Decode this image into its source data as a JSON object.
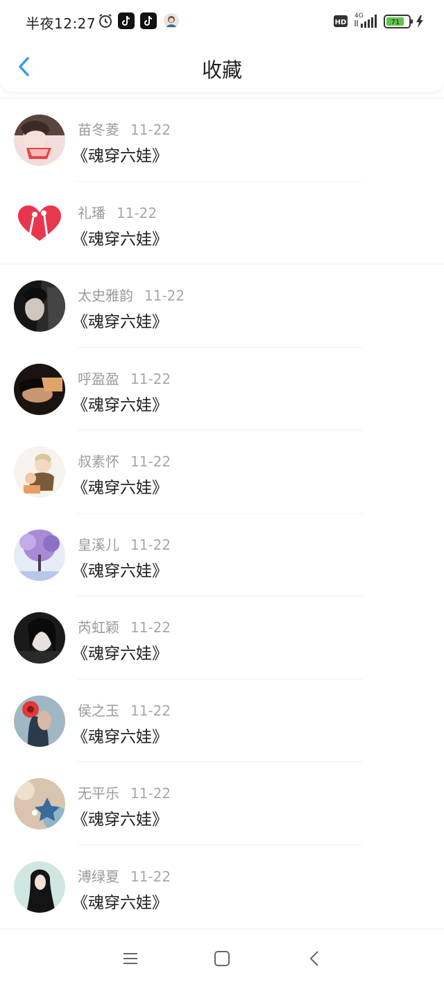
{
  "status_bar": {
    "time": "半夜12:27",
    "hd_label": "HD",
    "network": "4G",
    "battery": "71",
    "icons": [
      "alarm-icon",
      "tiktok-icon",
      "tiktok-icon",
      "profile-icon",
      "hd-icon",
      "signal-icon",
      "battery-icon",
      "charging-icon"
    ]
  },
  "header": {
    "title": "收藏",
    "back_icon": "chevron-left-icon",
    "accent_color": "#2d9cf0"
  },
  "favorites": [
    {
      "name": "苗冬菱",
      "date": "11-22",
      "book": "《魂穿六娃》"
    },
    {
      "name": "礼璠",
      "date": "11-22",
      "book": "《魂穿六娃》"
    },
    {
      "name": "太史雅韵",
      "date": "11-22",
      "book": "《魂穿六娃》"
    },
    {
      "name": "呼盈盈",
      "date": "11-22",
      "book": "《魂穿六娃》"
    },
    {
      "name": "叔素怀",
      "date": "11-22",
      "book": "《魂穿六娃》"
    },
    {
      "name": "皇溪儿",
      "date": "11-22",
      "book": "《魂穿六娃》"
    },
    {
      "name": "芮虹颖",
      "date": "11-22",
      "book": "《魂穿六娃》"
    },
    {
      "name": "侯之玉",
      "date": "11-22",
      "book": "《魂穿六娃》"
    },
    {
      "name": "无平乐",
      "date": "11-22",
      "book": "《魂穿六娃》"
    },
    {
      "name": "溥绿夏",
      "date": "11-22",
      "book": "《魂穿六娃》"
    }
  ],
  "nav_bar": {
    "icons": [
      "menu-icon",
      "home-square-icon",
      "back-triangle-icon"
    ]
  }
}
